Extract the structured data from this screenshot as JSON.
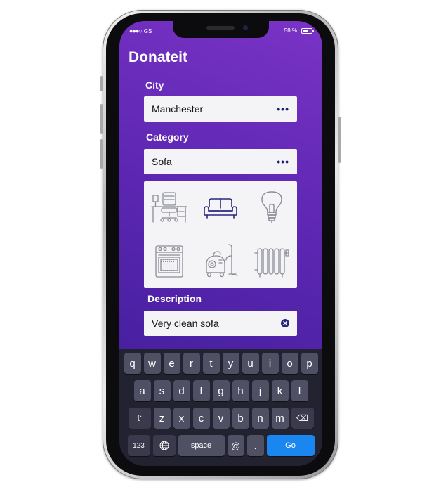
{
  "status_bar": {
    "carrier": "GS",
    "signal_dots": "●●●○",
    "battery_text": "58 %",
    "battery_level": 0.58
  },
  "app": {
    "title": "Donateit"
  },
  "form": {
    "city": {
      "label": "City",
      "value": "Manchester",
      "menu_icon": "more-dots-icon"
    },
    "category": {
      "label": "Category",
      "value": "Sofa",
      "menu_icon": "more-dots-icon"
    },
    "category_options": [
      {
        "icon": "desk-chair-icon",
        "selected": false
      },
      {
        "icon": "sofa-icon",
        "selected": true
      },
      {
        "icon": "light-bulb-icon",
        "selected": false
      },
      {
        "icon": "oven-icon",
        "selected": false
      },
      {
        "icon": "vacuum-cleaner-icon",
        "selected": false
      },
      {
        "icon": "radiator-icon",
        "selected": false
      }
    ],
    "description": {
      "label": "Description",
      "value": "Very clean sofa",
      "clear_icon": "clear-icon"
    }
  },
  "keyboard": {
    "row1": [
      "q",
      "w",
      "e",
      "r",
      "t",
      "y",
      "u",
      "i",
      "o",
      "p"
    ],
    "row2": [
      "a",
      "s",
      "d",
      "f",
      "g",
      "h",
      "j",
      "k",
      "l"
    ],
    "row3": [
      "z",
      "x",
      "c",
      "v",
      "b",
      "n",
      "m"
    ],
    "shift_icon": "⇧",
    "delete_icon": "⌫",
    "numbers_label": "123",
    "globe_icon": "🌐",
    "space_label": "space",
    "at_label": "@",
    "dot_label": ".",
    "go_label": "Go"
  },
  "colors": {
    "accent": "#1a86f0",
    "selected_icon": "#2a2680",
    "icon_gray": "#8c8c96"
  }
}
